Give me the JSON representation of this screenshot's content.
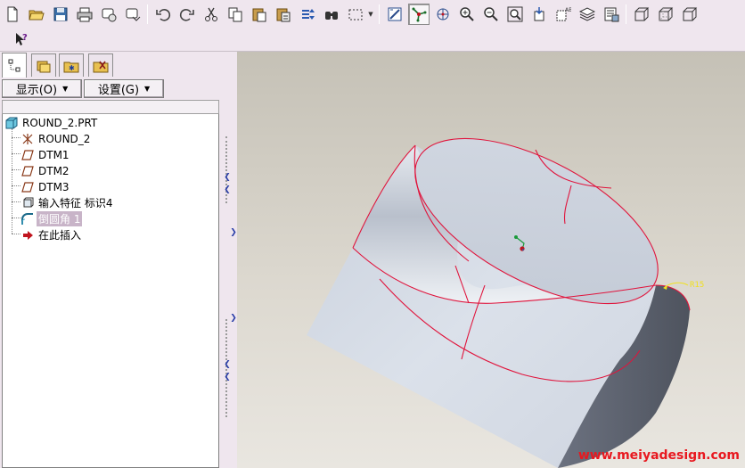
{
  "toolbar": {
    "row1": [
      {
        "name": "new-file-icon",
        "type": "btn"
      },
      {
        "name": "open-folder-icon",
        "type": "btn"
      },
      {
        "name": "save-icon",
        "type": "btn"
      },
      {
        "name": "print-icon",
        "type": "btn"
      },
      {
        "name": "email-icon",
        "type": "btn"
      },
      {
        "name": "email-attach-icon",
        "type": "btn"
      },
      {
        "name": "sep"
      },
      {
        "name": "undo-icon",
        "type": "btn"
      },
      {
        "name": "redo-icon",
        "type": "btn"
      },
      {
        "name": "cut-icon",
        "type": "btn"
      },
      {
        "name": "copy-icon",
        "type": "btn"
      },
      {
        "name": "paste-icon",
        "type": "btn"
      },
      {
        "name": "paste-special-icon",
        "type": "btn"
      },
      {
        "name": "regenerate-icon",
        "type": "btn"
      },
      {
        "name": "find-icon",
        "type": "btn"
      },
      {
        "name": "select-box-icon",
        "type": "btn"
      },
      {
        "name": "dropdown"
      },
      {
        "name": "sep"
      },
      {
        "name": "repaint-icon",
        "type": "btn"
      },
      {
        "name": "spin-center-icon",
        "type": "btn",
        "pressed": true
      },
      {
        "name": "orient-mode-icon",
        "type": "btn"
      },
      {
        "name": "zoom-in-icon",
        "type": "btn"
      },
      {
        "name": "zoom-out-icon",
        "type": "btn"
      },
      {
        "name": "refit-icon",
        "type": "btn"
      },
      {
        "name": "reorient-icon",
        "type": "btn"
      },
      {
        "name": "saved-views-icon",
        "type": "btn"
      },
      {
        "name": "layers-icon",
        "type": "btn"
      },
      {
        "name": "view-manager-icon",
        "type": "btn"
      },
      {
        "name": "sep"
      },
      {
        "name": "wireframe-icon",
        "type": "btn"
      },
      {
        "name": "hidden-line-icon",
        "type": "btn"
      },
      {
        "name": "no-hidden-icon",
        "type": "btn"
      }
    ],
    "row2": [
      {
        "name": "context-help-icon",
        "type": "btn"
      }
    ]
  },
  "tabs": [
    {
      "name": "tab-model-tree",
      "icon": "model-tree-icon",
      "active": true
    },
    {
      "name": "tab-folder-browser",
      "icon": "folder-browser-icon",
      "active": false
    },
    {
      "name": "tab-favorites",
      "icon": "favorites-icon",
      "active": false
    },
    {
      "name": "tab-connections",
      "icon": "connections-icon",
      "active": false
    }
  ],
  "menu": {
    "show_label": "显示(O)",
    "settings_label": "设置(G)"
  },
  "tree": {
    "root": "ROUND_2.PRT",
    "items": [
      {
        "label": "ROUND_2",
        "icon": "csys-icon",
        "selected": false
      },
      {
        "label": "DTM1",
        "icon": "datum-plane-icon",
        "selected": false
      },
      {
        "label": "DTM2",
        "icon": "datum-plane-icon",
        "selected": false
      },
      {
        "label": "DTM3",
        "icon": "datum-plane-icon",
        "selected": false
      },
      {
        "label": "输入特征 标识4",
        "icon": "import-feature-icon",
        "selected": false
      },
      {
        "label": "倒圆角 1",
        "icon": "round-icon",
        "selected": true
      },
      {
        "label": "在此插入",
        "icon": "insert-here-icon",
        "selected": false
      }
    ]
  },
  "viewport": {
    "dimension_label": "R15",
    "watermark": "www.meiyadesign.com"
  },
  "colors": {
    "toolbar_bg": "#efe6ee",
    "edge_highlight": "#e0143c",
    "selected_item": "#c8b4c8",
    "model_face": "#d0d6e2",
    "watermark": "#e8181f"
  }
}
